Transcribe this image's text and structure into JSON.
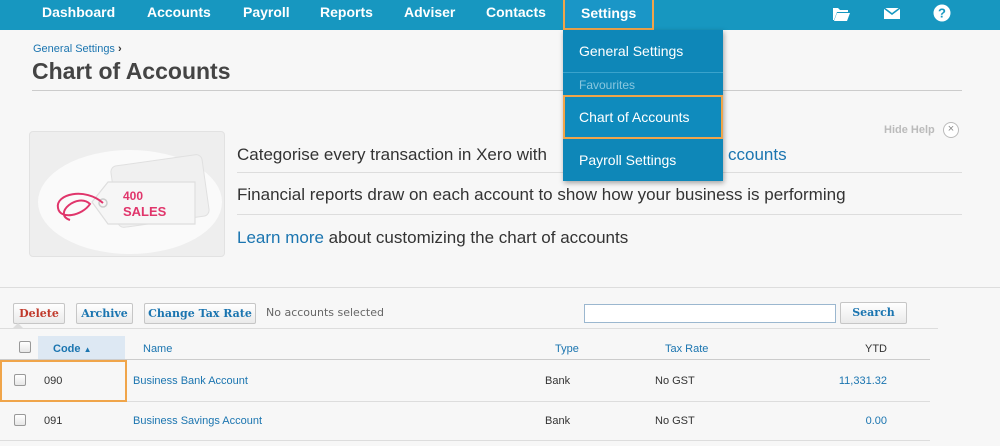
{
  "nav": {
    "items": [
      "Dashboard",
      "Accounts",
      "Payroll",
      "Reports",
      "Adviser",
      "Contacts",
      "Settings"
    ],
    "icons": [
      "folder-icon",
      "mail-icon",
      "help-icon"
    ]
  },
  "settings_menu": {
    "general": "General Settings",
    "favourites_heading": "Favourites",
    "chart_of_accounts": "Chart of Accounts",
    "payroll_settings": "Payroll Settings"
  },
  "breadcrumb": {
    "parent": "General Settings",
    "separator": "›"
  },
  "page_title": "Chart of Accounts",
  "help": {
    "tag_code": "400",
    "tag_name": "SALES",
    "line1_text": "Categorise every transaction in Xero with",
    "line1_link": "ccounts",
    "line2": "Financial reports draw on each account to show how your business is performing",
    "line3_link": "Learn more",
    "line3_rest": "about customizing the chart of accounts",
    "hide_label": "Hide Help",
    "close_glyph": "×"
  },
  "toolbar": {
    "delete": "Delete",
    "archive": "Archive",
    "change_tax_rate": "Change Tax Rate",
    "selection_status": "No accounts selected",
    "search_value": "",
    "search_button": "Search"
  },
  "table": {
    "columns": {
      "code": "Code",
      "sort_glyph": "▲",
      "name": "Name",
      "type": "Type",
      "tax_rate": "Tax Rate",
      "ytd": "YTD"
    },
    "rows": [
      {
        "code": "090",
        "name": "Business Bank Account",
        "type": "Bank",
        "tax_rate": "No GST",
        "ytd": "11,331.32"
      },
      {
        "code": "091",
        "name": "Business Savings Account",
        "type": "Bank",
        "tax_rate": "No GST",
        "ytd": "0.00"
      }
    ]
  },
  "colors": {
    "nav_bg": "#1797c0",
    "menu_bg": "#0e87b8",
    "highlight": "#f0a54a",
    "link": "#1b75b0",
    "tag_pink": "#e0356b"
  }
}
